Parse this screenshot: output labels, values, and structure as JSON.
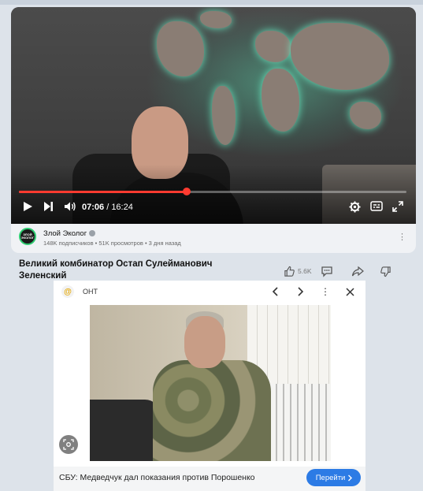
{
  "player": {
    "current_time": "07:06",
    "separator": " / ",
    "duration": "16:24",
    "progress_fraction": 0.4327,
    "accent": "#ff3b30"
  },
  "channel": {
    "avatar_text": "ЗЛОЙ ЭКОЛОГ",
    "name": "Злой Эколог",
    "meta": "148K подписчиков • 51K просмотров • 3 дня назад"
  },
  "video": {
    "title": "Великий комбинатор Остап Сулейманович Зеленский",
    "like_count": "5.6K"
  },
  "ad": {
    "source": "ОНТ",
    "text": "СБУ: Медведчук дал показания против Порошенко",
    "cta": "Перейти",
    "cta_color": "#2c7be5"
  },
  "icons": {
    "play": "play-icon",
    "next": "next-icon",
    "volume": "volume-icon",
    "settings": "gear-icon",
    "subtitles": "subtitles-icon",
    "fullscreen": "fullscreen-icon",
    "like": "thumbs-up-icon",
    "comment": "comment-icon",
    "share": "share-icon",
    "dislike": "thumbs-down-icon"
  }
}
